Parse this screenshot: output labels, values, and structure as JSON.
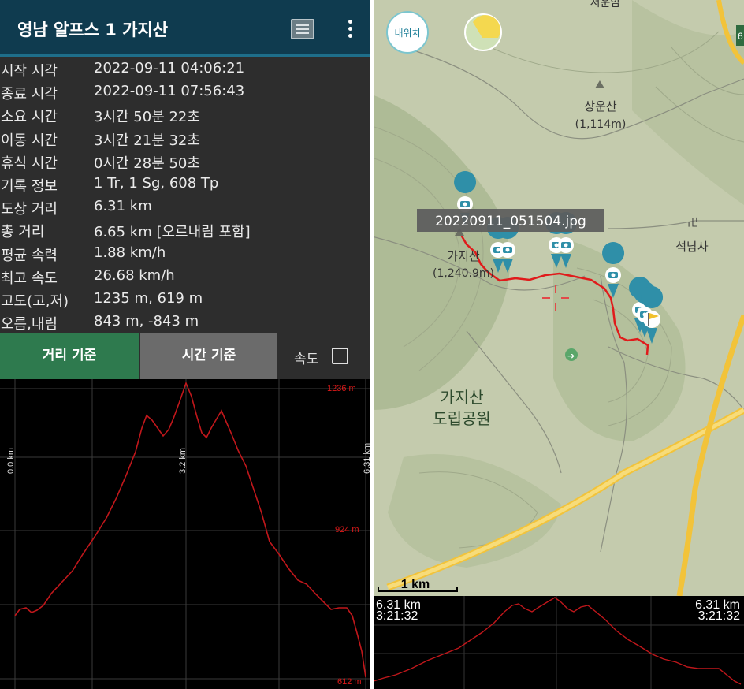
{
  "app": {
    "title": "영남 알프스 1 가지산",
    "list_icon": "list-icon",
    "more_icon": "more-vert-icon"
  },
  "stats": [
    {
      "label": "시작 시각",
      "value": "2022-09-11 04:06:21"
    },
    {
      "label": "종료 시각",
      "value": "2022-09-11 07:56:43"
    },
    {
      "label": "소요 시간",
      "value": "3시간 50분 22초"
    },
    {
      "label": "이동 시간",
      "value": "3시간 21분 32초"
    },
    {
      "label": "휴식 시간",
      "value": "0시간 28분 50초"
    },
    {
      "label": "기록 정보",
      "value": "1 Tr, 1 Sg, 608 Tp"
    },
    {
      "label": "도상 거리",
      "value": "6.31 km"
    },
    {
      "label": "총 거리",
      "value": "6.65 km [오르내림 포함]"
    },
    {
      "label": "평균 속력",
      "value": "1.88 km/h"
    },
    {
      "label": "최고 속도",
      "value": "26.68 km/h"
    },
    {
      "label": "고도(고,저)",
      "value": "1235 m, 619 m"
    },
    {
      "label": "오름,내림",
      "value": "843 m, -843 m"
    }
  ],
  "buttons": {
    "distance": "거리 기준",
    "time": "시간 기준",
    "speed_label": "속도",
    "speed_checked": false
  },
  "profile": {
    "max_label": "1236 m",
    "mid_label": "924 m",
    "min_label": "612 m",
    "x_start": "0.0 km",
    "x_mid": "3.2 km",
    "x_end": "6.31 km",
    "line_color": "#c0171b",
    "label_color": "#e01a1a"
  },
  "map": {
    "top_label": "서운암",
    "location_button": "내위치",
    "photo_tooltip": "20220911_051504.jpg",
    "peak1_name": "상운산",
    "peak1_elev": "(1,114m)",
    "peak2_name": "가지산",
    "peak2_elev": "(1,240.9m)",
    "temple": "석남사",
    "park_line1": "가지산",
    "park_line2": "도립공원",
    "scale": "1 km",
    "road_label": "6",
    "track_color": "#e01b1b",
    "marker_color": "#2f8fa8",
    "flag_color": "#f2c12e"
  },
  "mini_profile": {
    "left_dist": "6.31 km",
    "left_time": "3:21:32",
    "right_dist": "6.31 km",
    "right_time": "3:21:32"
  }
}
